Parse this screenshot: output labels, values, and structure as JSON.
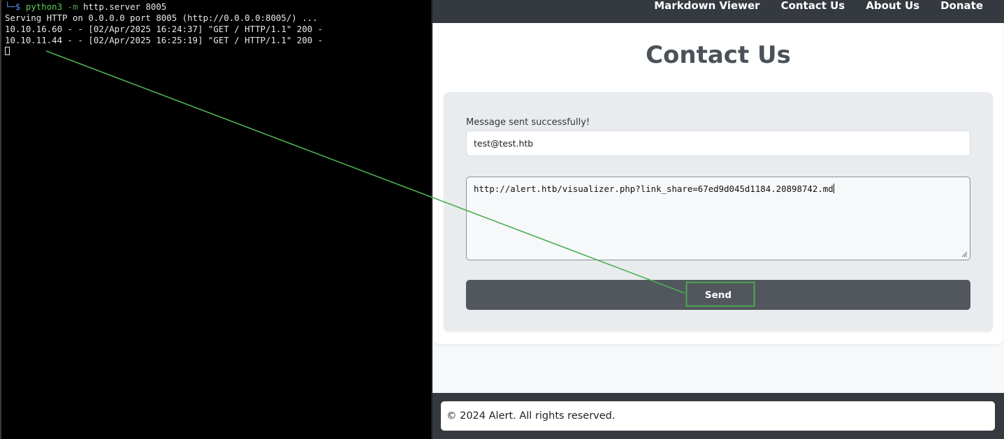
{
  "terminal": {
    "prompt_glyph": "└─$",
    "command_python": "python3",
    "command_flag": "-m",
    "command_rest": "http.server 8005",
    "lines": [
      "Serving HTTP on 0.0.0.0 port 8005 (http://0.0.0.0:8005/) ...",
      "10.10.16.60 - - [02/Apr/2025 16:24:37] \"GET / HTTP/1.1\" 200 -",
      "10.10.11.44 - - [02/Apr/2025 16:25:19] \"GET / HTTP/1.1\" 200 -"
    ]
  },
  "nav": {
    "items": [
      "Markdown Viewer",
      "Contact Us",
      "About Us",
      "Donate"
    ]
  },
  "page": {
    "title": "Contact Us"
  },
  "form": {
    "status": "Message sent successfully!",
    "email_value": "test@test.htb",
    "message_value": "http://alert.htb/visualizer.php?link_share=67ed9d045d1184.20898742.md",
    "send_label": "Send"
  },
  "footer": {
    "text": "© 2024 Alert. All rights reserved."
  },
  "colors": {
    "navbar": "#343a40",
    "button": "#52575e",
    "annotation": "#4caf50"
  }
}
